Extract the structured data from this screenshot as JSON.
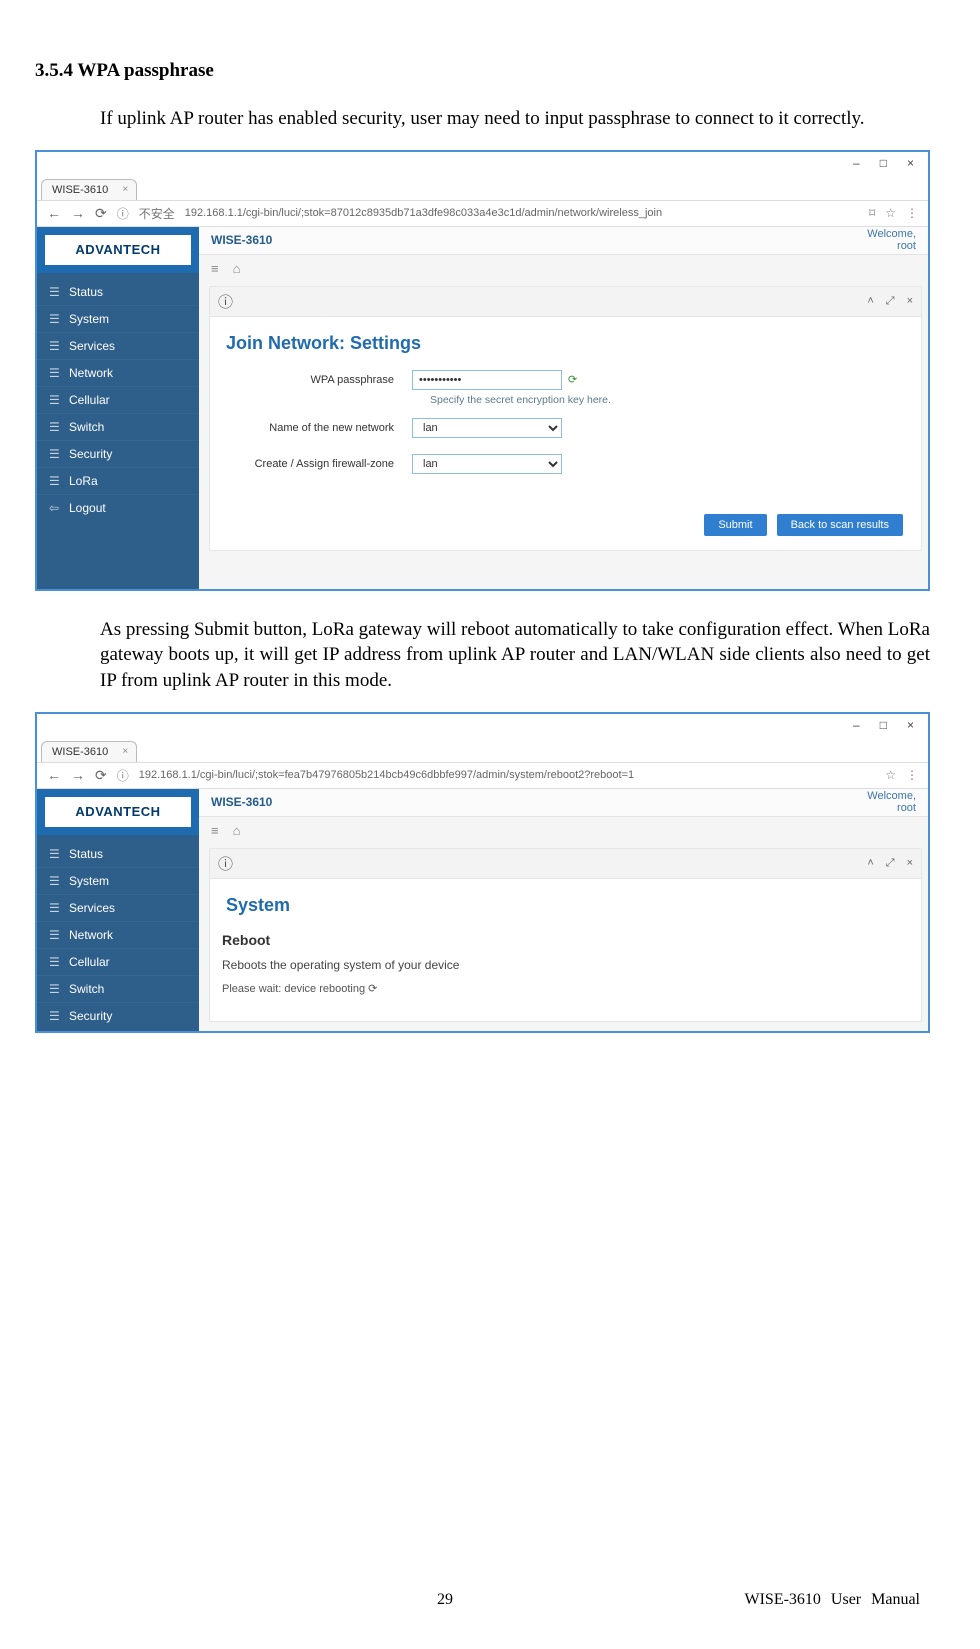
{
  "doc": {
    "section_heading": "3.5.4 WPA passphrase",
    "para1": "If uplink AP router has enabled security, user may need to input passphrase to connect to it correctly.",
    "para2": "As pressing Submit button, LoRa gateway will reboot automatically to take configuration effect. When LoRa gateway boots up, it will get IP address from uplink AP router and LAN/WLAN side clients also need to get IP from uplink AP router in this mode.",
    "page_number": "29",
    "manual_title": "WISE-3610  User  Manual"
  },
  "shot1": {
    "win_min": "–",
    "win_max": "□",
    "win_close": "×",
    "tab_title": "WISE-3610",
    "url_prefix": "不安全",
    "url": "192.168.1.1/cgi-bin/luci/;stok=87012c8935db71a3dfe98c033a4e3c1d/admin/network/wireless_join",
    "brand": "ADVANTECH",
    "app_title": "WISE-3610",
    "welcome1": "Welcome,",
    "welcome2": "root",
    "sidebar": [
      "Status",
      "System",
      "Services",
      "Network",
      "Cellular",
      "Switch",
      "Security",
      "LoRa",
      "Logout"
    ],
    "panel_title": "Join Network: Settings",
    "f_pass_label": "WPA passphrase",
    "f_pass_value": "•••••••••••",
    "f_pass_help": "Specify the secret encryption key here.",
    "f_net_label": "Name of the new network",
    "f_net_value": "lan",
    "f_zone_label": "Create / Assign firewall-zone",
    "f_zone_value": "lan",
    "btn_submit": "Submit",
    "btn_back": "Back to scan results"
  },
  "shot2": {
    "win_min": "–",
    "win_max": "□",
    "win_close": "×",
    "tab_title": "WISE-3610",
    "url": "192.168.1.1/cgi-bin/luci/;stok=fea7b47976805b214bcb49c6dbbfe997/admin/system/reboot2?reboot=1",
    "brand": "ADVANTECH",
    "app_title": "WISE-3610",
    "welcome1": "Welcome,",
    "welcome2": "root",
    "sidebar": [
      "Status",
      "System",
      "Services",
      "Network",
      "Cellular",
      "Switch",
      "Security"
    ],
    "panel_title": "System",
    "reboot_heading": "Reboot",
    "reboot_desc": "Reboots the operating system of your device",
    "wait_msg": "Please wait: device rebooting ⟳"
  }
}
